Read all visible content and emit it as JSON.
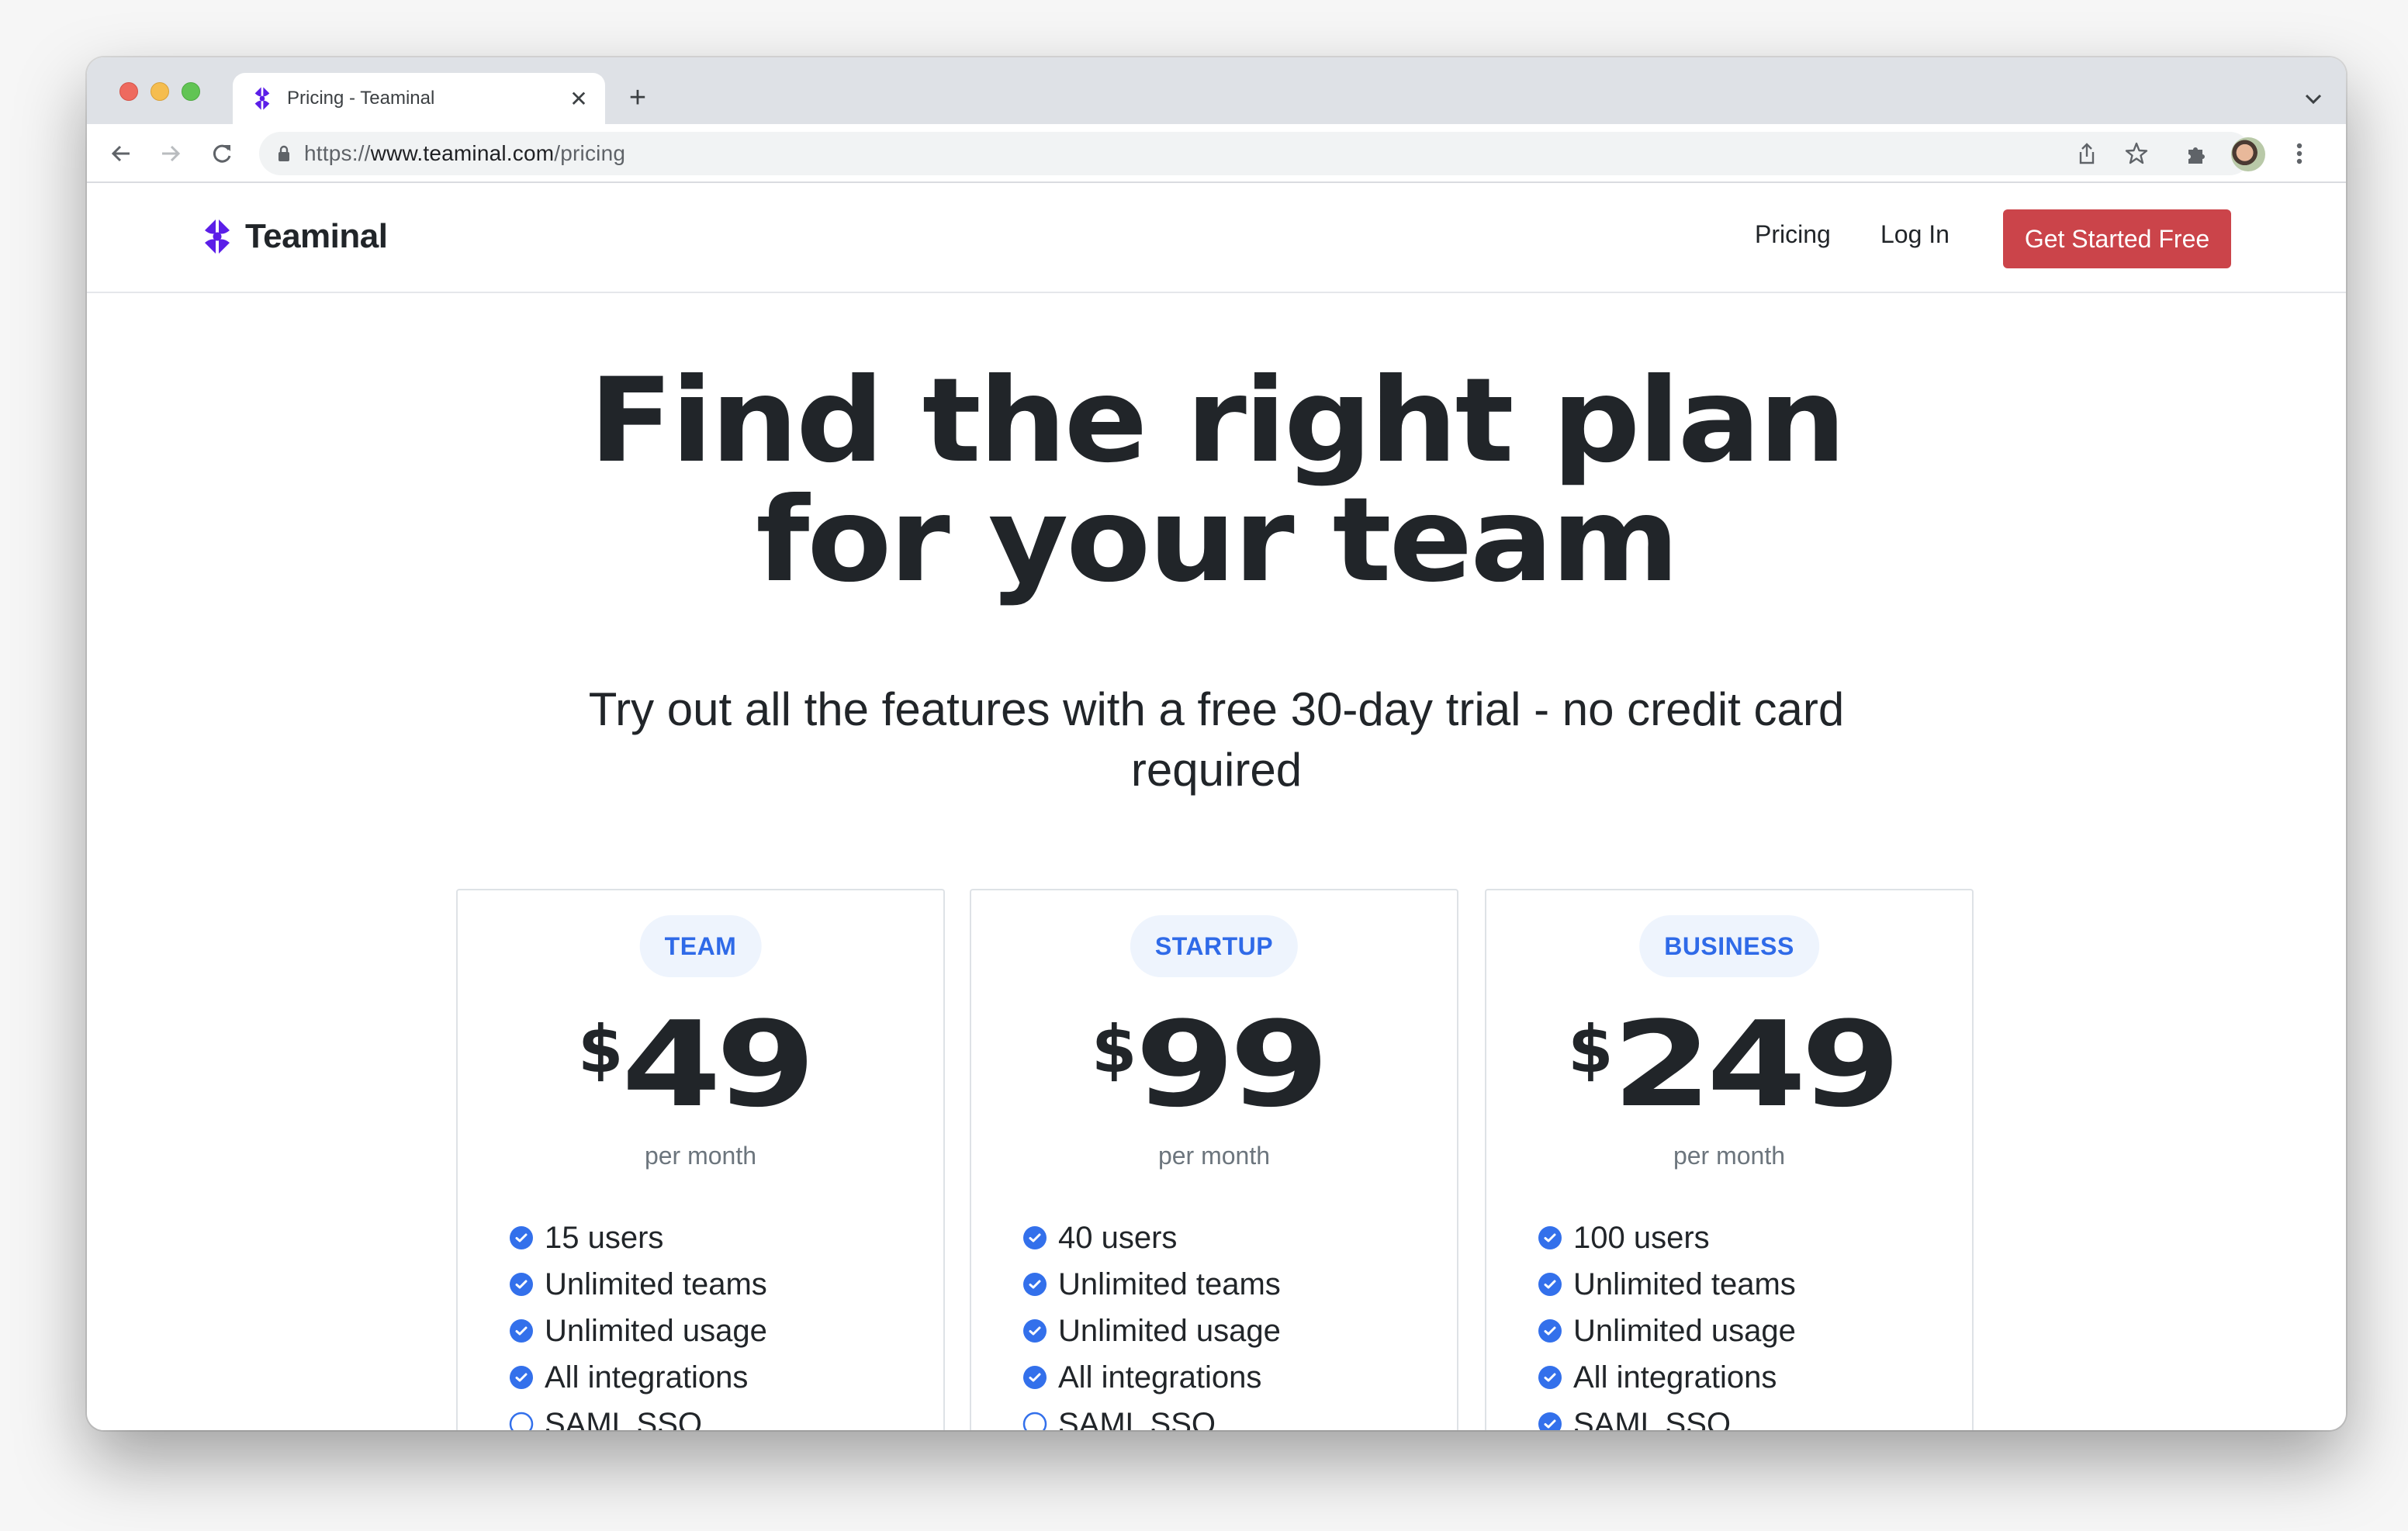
{
  "browser": {
    "tab_title": "Pricing - Teaminal",
    "url_scheme": "https://",
    "url_host": "www.teaminal.com",
    "url_path": "/pricing",
    "icons": {
      "back": "arrow-left-icon",
      "forward": "arrow-right-icon",
      "reload": "reload-icon",
      "lock": "lock-icon",
      "share": "share-icon",
      "bookmark": "star-icon",
      "extensions": "puzzle-icon",
      "profile": "avatar",
      "menu": "kebab-menu-icon",
      "tab_close": "close-icon",
      "new_tab": "plus-icon",
      "tab_list": "chevron-down-icon"
    },
    "tab_close_glyph": "✕",
    "new_tab_glyph": "+"
  },
  "header": {
    "brand_name": "Teaminal",
    "brand_color": "#5b1ee8",
    "nav": [
      {
        "label": "Pricing"
      },
      {
        "label": "Log In"
      }
    ],
    "cta_label": "Get Started Free",
    "cta_color": "#cb444a"
  },
  "hero": {
    "title_line1": "Find the right plan",
    "title_line2": "for your team",
    "subtitle": "Try out all the features with a free 30-day trial - no credit card required"
  },
  "plans": [
    {
      "name": "TEAM",
      "currency": "$",
      "price": "49",
      "period": "per month",
      "features": [
        {
          "label": "15 users",
          "included": true
        },
        {
          "label": "Unlimited teams",
          "included": true
        },
        {
          "label": "Unlimited usage",
          "included": true
        },
        {
          "label": "All integrations",
          "included": true
        },
        {
          "label": "SAML SSO",
          "included": false
        }
      ]
    },
    {
      "name": "STARTUP",
      "currency": "$",
      "price": "99",
      "period": "per month",
      "features": [
        {
          "label": "40 users",
          "included": true
        },
        {
          "label": "Unlimited teams",
          "included": true
        },
        {
          "label": "Unlimited usage",
          "included": true
        },
        {
          "label": "All integrations",
          "included": true
        },
        {
          "label": "SAML SSO",
          "included": false
        }
      ]
    },
    {
      "name": "BUSINESS",
      "currency": "$",
      "price": "249",
      "period": "per month",
      "features": [
        {
          "label": "100 users",
          "included": true
        },
        {
          "label": "Unlimited teams",
          "included": true
        },
        {
          "label": "Unlimited usage",
          "included": true
        },
        {
          "label": "All integrations",
          "included": true
        },
        {
          "label": "SAML SSO",
          "included": true
        }
      ]
    }
  ],
  "colors": {
    "accent_blue": "#3370eb",
    "badge_bg": "#eef4fd",
    "text_dark": "#212529",
    "text_muted": "#6c757d"
  }
}
